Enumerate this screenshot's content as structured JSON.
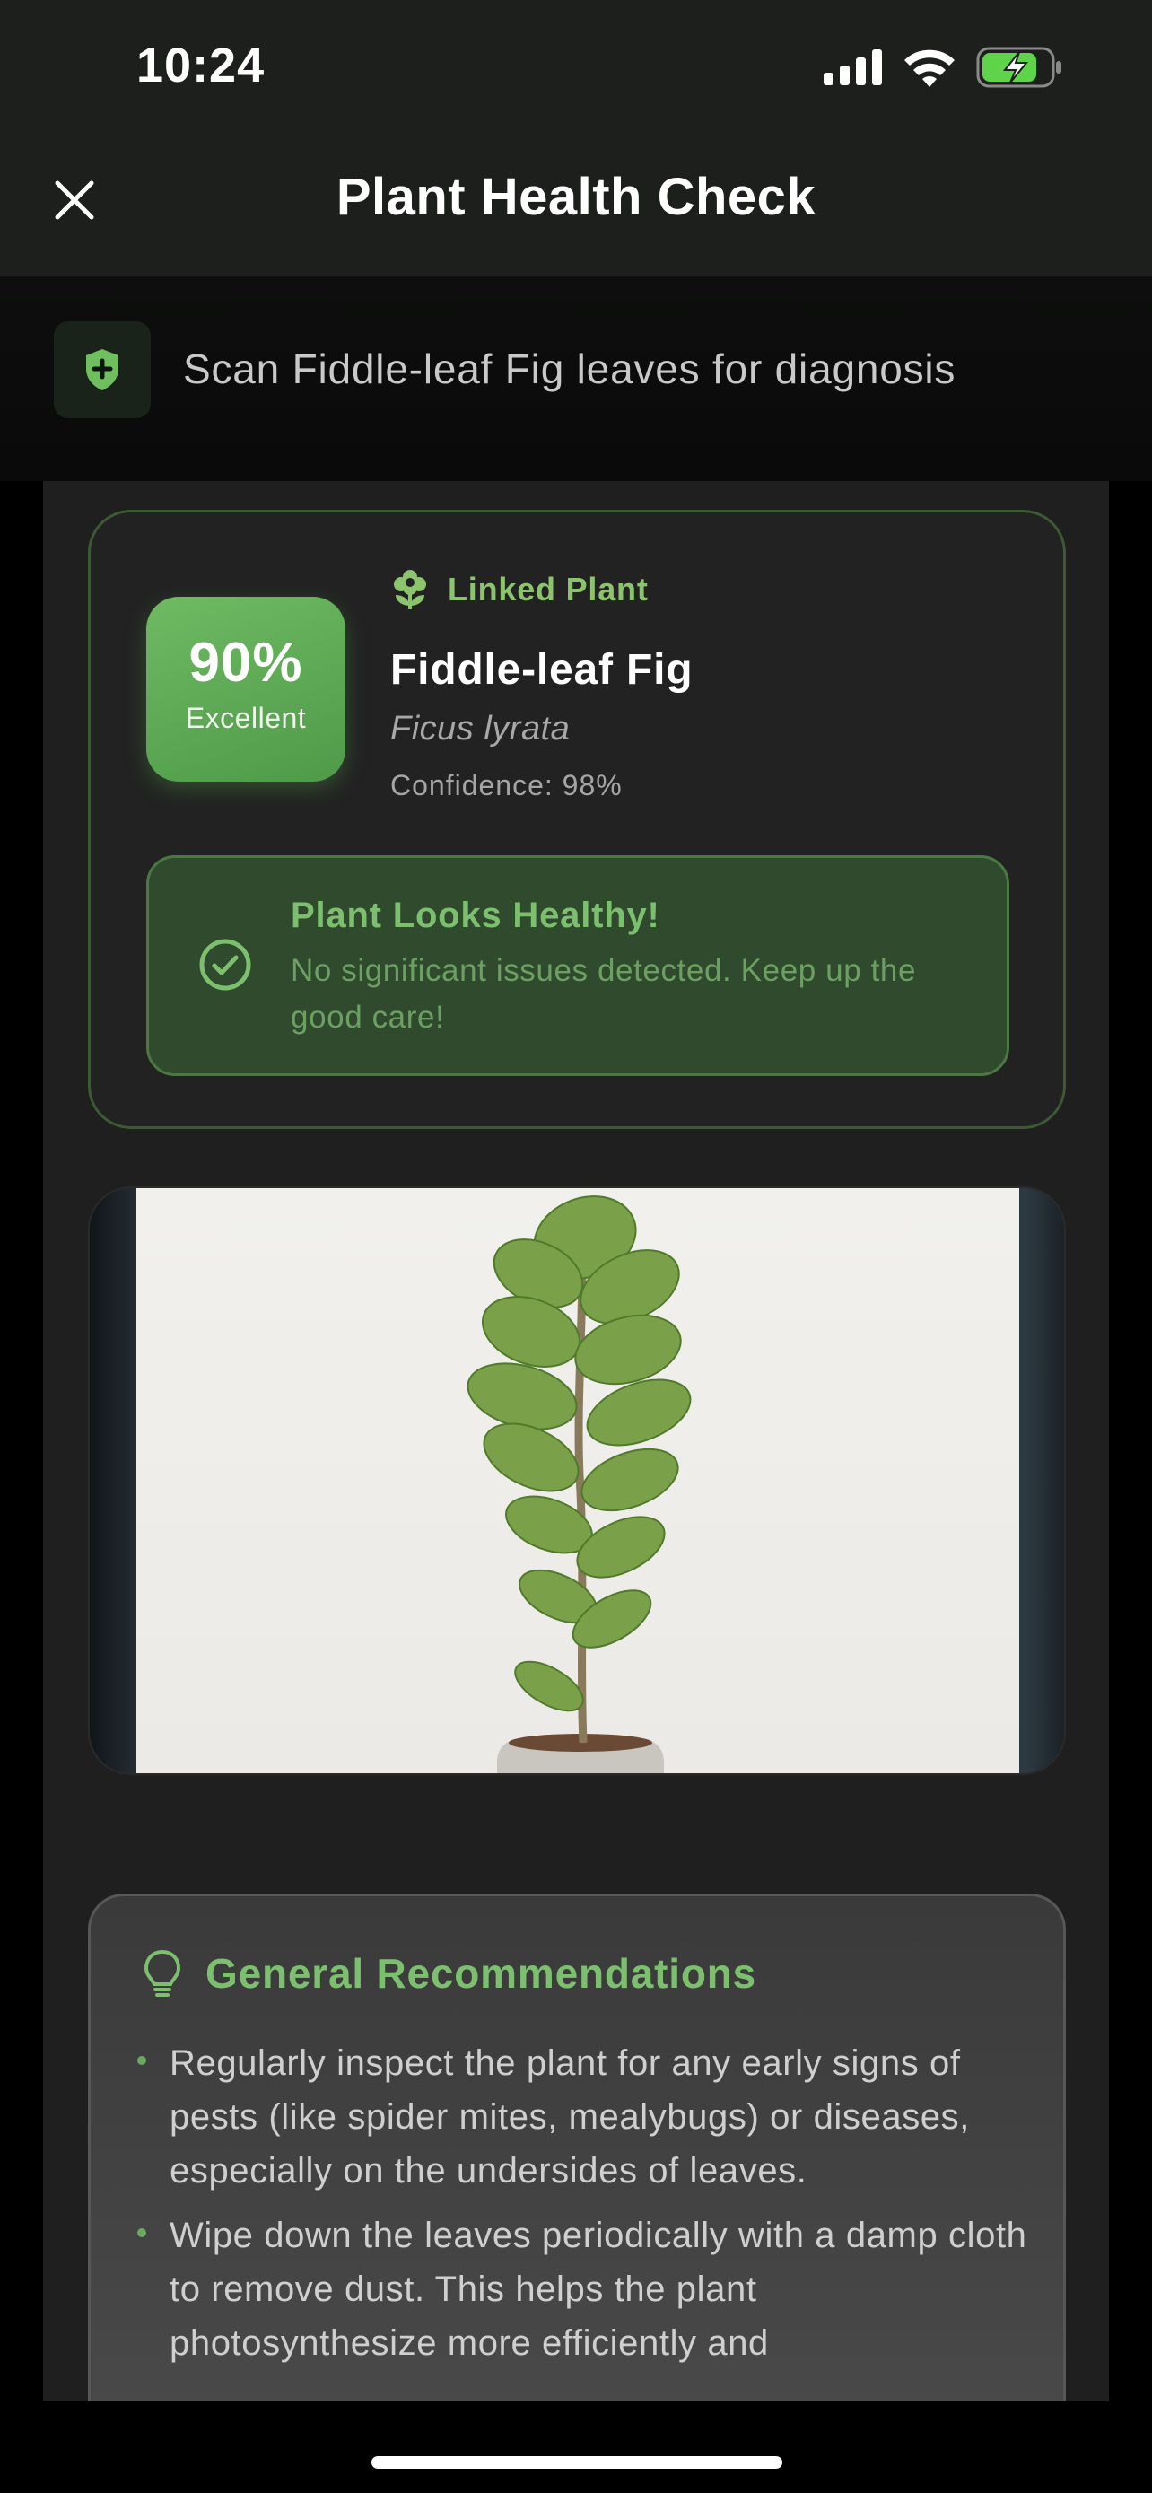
{
  "status_bar": {
    "time": "10:24",
    "icons": [
      "cellular-signal-icon",
      "wifi-icon",
      "battery-charging-icon"
    ]
  },
  "header": {
    "title": "Plant Health Check",
    "close_icon": "close-icon"
  },
  "info_bar": {
    "icon": "shield-plus-icon",
    "text": "Scan Fiddle-leaf Fig leaves for diagnosis"
  },
  "summary": {
    "score": "90%",
    "score_label": "Excellent",
    "linked_label": "Linked Plant",
    "linked_icon": "flower-icon",
    "plant_name": "Fiddle-leaf Fig",
    "scientific_name": "Ficus lyrata",
    "confidence": "Confidence: 98%",
    "health": {
      "icon": "check-circle-icon",
      "title": "Plant Looks Healthy!",
      "description": "No significant issues detected. Keep up the good care!"
    }
  },
  "photo": {
    "subject": "fiddle-leaf-fig-plant"
  },
  "recommendations": {
    "icon": "lightbulb-icon",
    "title": "General Recommendations",
    "items": [
      "Regularly inspect the plant for any early signs of pests (like spider mites, mealybugs) or diseases, especially on the undersides of leaves.",
      "Wipe down the leaves periodically with a damp cloth to remove dust. This helps the plant photosynthesize more efficiently and"
    ]
  },
  "colors": {
    "accent_green": "#7cc06f",
    "score_green": "#5fae55",
    "card_border": "#3c5a34"
  }
}
